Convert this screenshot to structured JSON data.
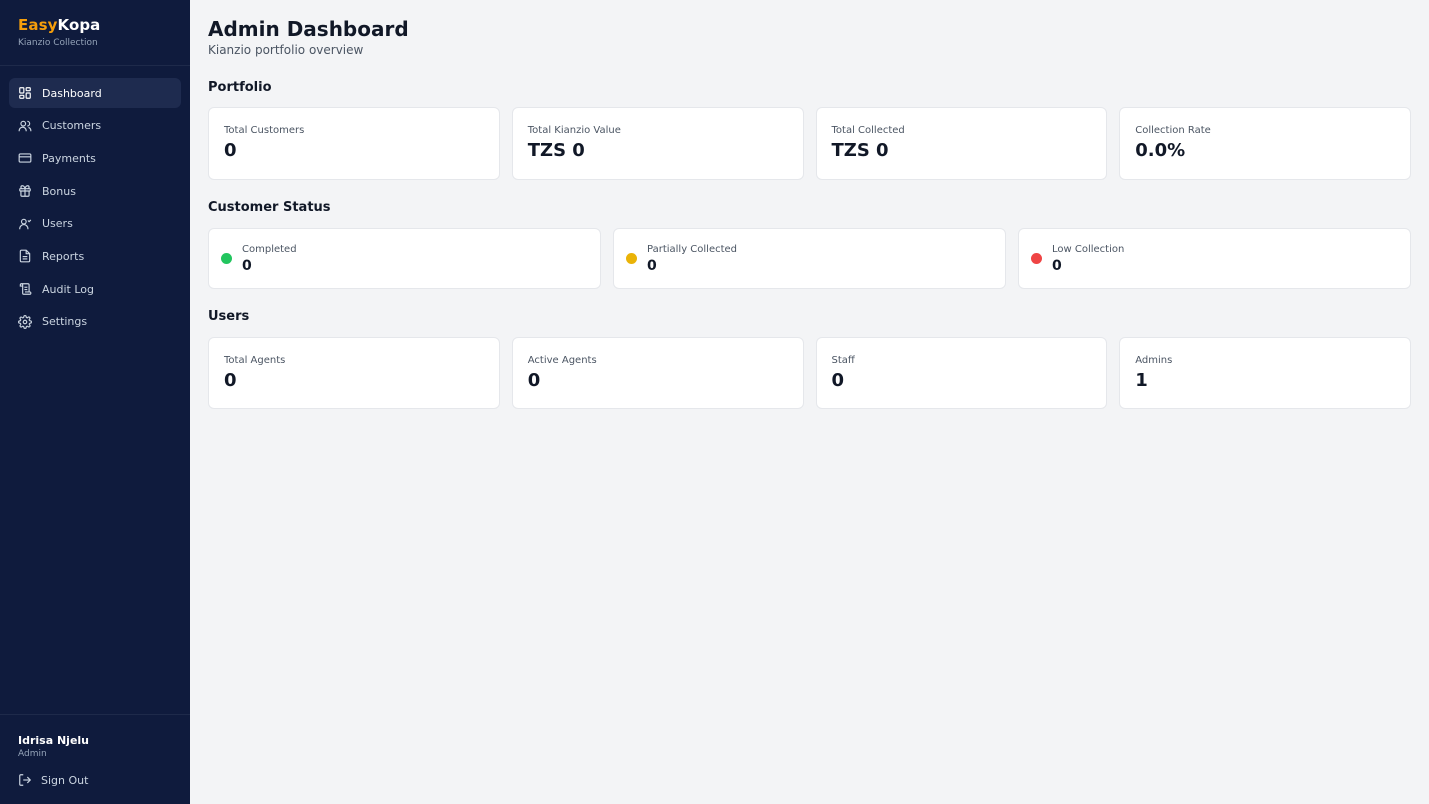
{
  "brand": {
    "part1": "Easy",
    "part2": "Kopa",
    "subtitle": "Kianzio Collection"
  },
  "nav": [
    {
      "label": "Dashboard",
      "icon": "dashboard-icon",
      "active": true
    },
    {
      "label": "Customers",
      "icon": "users-icon"
    },
    {
      "label": "Payments",
      "icon": "credit-card-icon"
    },
    {
      "label": "Bonus",
      "icon": "gift-icon"
    },
    {
      "label": "Users",
      "icon": "user-icon"
    },
    {
      "label": "Reports",
      "icon": "document-icon"
    },
    {
      "label": "Audit Log",
      "icon": "audit-icon"
    },
    {
      "label": "Settings",
      "icon": "gear-icon"
    }
  ],
  "user": {
    "name": "Idrisa Njelu",
    "role": "Admin",
    "signout": "Sign Out"
  },
  "header": {
    "title": "Admin Dashboard",
    "subtitle": "Kianzio portfolio overview"
  },
  "portfolio": {
    "title": "Portfolio",
    "cards": [
      {
        "label": "Total Customers",
        "value": "0"
      },
      {
        "label": "Total Kianzio Value",
        "value": "TZS 0"
      },
      {
        "label": "Total Collected",
        "value": "TZS 0"
      },
      {
        "label": "Collection Rate",
        "value": "0.0%"
      }
    ]
  },
  "status": {
    "title": "Customer Status",
    "cards": [
      {
        "label": "Completed",
        "value": "0",
        "color": "#22c55e"
      },
      {
        "label": "Partially Collected",
        "value": "0",
        "color": "#eab308"
      },
      {
        "label": "Low Collection",
        "value": "0",
        "color": "#ef4444"
      }
    ]
  },
  "users": {
    "title": "Users",
    "cards": [
      {
        "label": "Total Agents",
        "value": "0"
      },
      {
        "label": "Active Agents",
        "value": "0"
      },
      {
        "label": "Staff",
        "value": "0"
      },
      {
        "label": "Admins",
        "value": "1"
      }
    ]
  },
  "colors": {
    "sidebar_bg": "#0f1b3d",
    "brand_accent": "#f59e0b",
    "page_bg": "#f3f4f6"
  }
}
